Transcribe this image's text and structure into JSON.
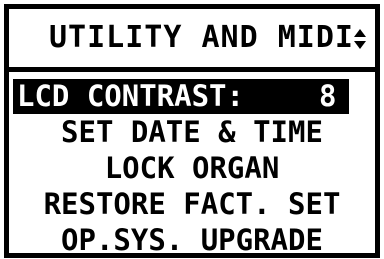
{
  "header": {
    "title": "UTILITY AND MIDI",
    "scroll_indicator_icon": "up-down-arrows-icon"
  },
  "menu": {
    "selected_index": 0,
    "items": [
      {
        "label": "LCD CONTRAST:",
        "value": "8"
      },
      {
        "label": "SET DATE & TIME"
      },
      {
        "label": "LOCK ORGAN"
      },
      {
        "label": "RESTORE FACT. SET"
      },
      {
        "label": "OP.SYS. UPGRADE"
      }
    ]
  },
  "colors": {
    "foreground": "#000000",
    "background": "#ffffff"
  }
}
